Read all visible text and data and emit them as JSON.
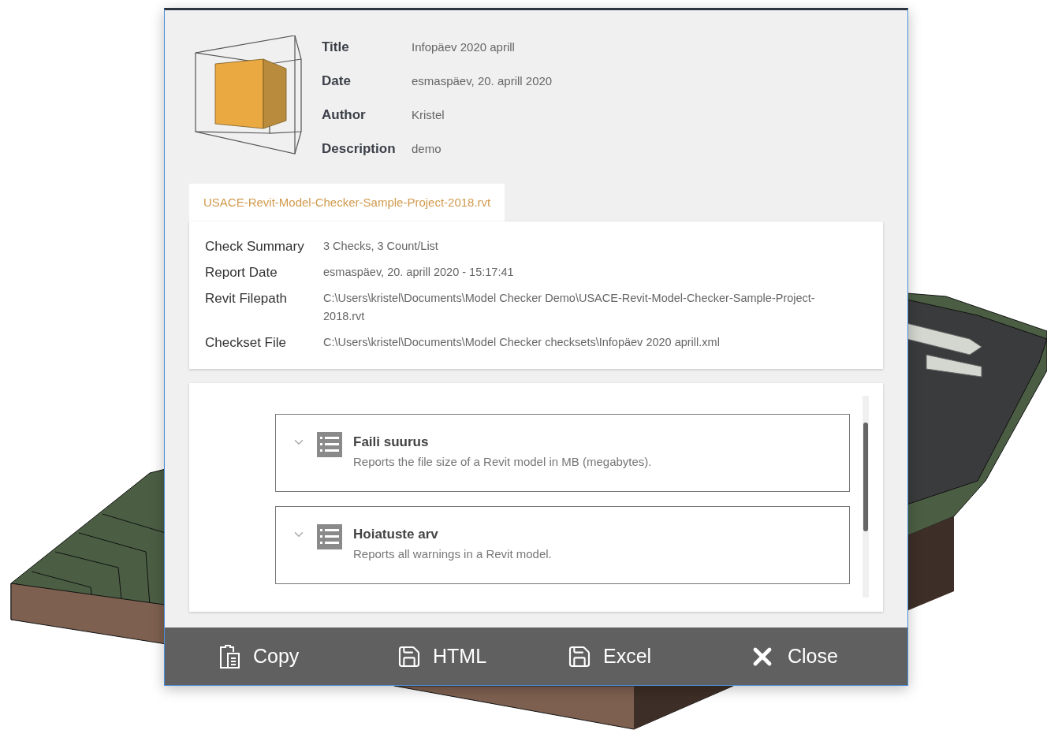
{
  "header": {
    "fields": [
      {
        "label": "Title",
        "value": "Infopäev 2020 aprill"
      },
      {
        "label": "Date",
        "value": "esmaspäev, 20. aprill 2020"
      },
      {
        "label": "Author",
        "value": "Kristel"
      },
      {
        "label": "Description",
        "value": "demo"
      }
    ]
  },
  "file_tab": {
    "label": "USACE-Revit-Model-Checker-Sample-Project-2018.rvt",
    "selected": true
  },
  "summary": [
    {
      "label": "Check Summary",
      "value": "3 Checks, 3 Count/List"
    },
    {
      "label": "Report Date",
      "value": "esmaspäev, 20. aprill 2020 - 15:17:41"
    },
    {
      "label": "Revit Filepath",
      "value": "C:\\Users\\kristel\\Documents\\Model Checker Demo\\USACE-Revit-Model-Checker-Sample-Project-2018.rvt"
    },
    {
      "label": "Checkset File",
      "value": "C:\\Users\\kristel\\Documents\\Model Checker checksets\\Infopäev 2020 aprill.xml"
    }
  ],
  "checks": [
    {
      "name": "Faili suurus",
      "description": "Reports the file size of a Revit model in MB (megabytes).",
      "expanded": false
    },
    {
      "name": "Hoiatuste arv",
      "description": "Reports all warnings in a Revit model.",
      "expanded": false
    }
  ],
  "actions": [
    {
      "kind": "copy",
      "label": "Copy"
    },
    {
      "kind": "html",
      "label": "HTML"
    },
    {
      "kind": "excel",
      "label": "Excel"
    },
    {
      "kind": "close",
      "label": "Close"
    }
  ]
}
